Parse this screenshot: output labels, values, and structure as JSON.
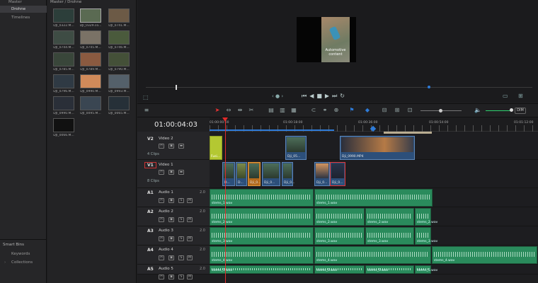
{
  "bins": {
    "root": "Master",
    "items": [
      "Drohne",
      "Timelines"
    ]
  },
  "smartbins": {
    "title": "Smart Bins",
    "items": [
      "Keywords",
      "Collections"
    ]
  },
  "mediapool": {
    "breadcrumb": "Master / Drohne",
    "clips": [
      "DJI_0322.M...",
      "DJI_0329.co...",
      "DJI_0741.M...",
      "DJI_0744.M...",
      "DJI_0745.M...",
      "DJI_0746.M...",
      "DJI_0785.M...",
      "DJI_0789.M...",
      "DJI_0790.M...",
      "DJI_0796.M...",
      "DJI_0990.M...",
      "DJI_0993.M...",
      "DJI_0990.M...",
      "DJI_0095.M...",
      "DJI_0065.M...",
      "DJI_0066.M..."
    ]
  },
  "viewer": {
    "overlay": "Automotive content"
  },
  "timecode": "01:00:04:03",
  "ruler": [
    "01:00:00:00",
    "01:00:18:00",
    "01:00:36:00",
    "01:00:54:00",
    "01:01:12:00"
  ],
  "toolbar": {
    "dim": "DIM"
  },
  "video_tracks": [
    {
      "id": "V2",
      "name": "Video 2",
      "clips": "4 Clips"
    },
    {
      "id": "V1",
      "name": "Video 1",
      "clips": "8 Clips"
    }
  ],
  "audio_tracks": [
    {
      "id": "A1",
      "name": "Audio 1",
      "vol": "2.0",
      "file": "stems_1.wav"
    },
    {
      "id": "A2",
      "name": "Audio 2",
      "vol": "2.0",
      "file": "stems_2.wav"
    },
    {
      "id": "A3",
      "name": "Audio 3",
      "vol": "2.0",
      "file": "stems_3.wav"
    },
    {
      "id": "A4",
      "name": "Audio 4",
      "vol": "2.0",
      "file": "stems_4.wav"
    },
    {
      "id": "A5",
      "name": "Audio 5",
      "vol": "2.0",
      "file": "stems_5.wav"
    }
  ],
  "v2clips": [
    "Fusi...",
    "Dji_05...",
    "Dji_0990.MP4"
  ],
  "v1clips": [
    "D...",
    "D...",
    "Dji_0...",
    "Dji_0...",
    "Dji_0...",
    "Dji_0...",
    "Dji_0...",
    "Dji_0..."
  ],
  "colors": {
    "playhead": "#e12b2b",
    "audio": "#2a8b5c",
    "video": "#2c4f7a",
    "fusion": "#b4c832",
    "accent": "#2e7bd8"
  }
}
